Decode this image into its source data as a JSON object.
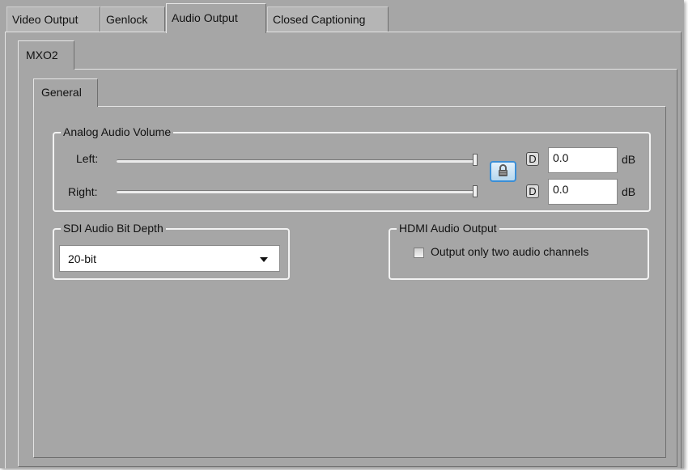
{
  "tabs": [
    "Video Output",
    "Genlock",
    "Audio Output",
    "Closed Captioning"
  ],
  "active_tab": "Audio Output",
  "device_tab": "MXO2",
  "section_tab": "General",
  "analog_volume": {
    "title": "Analog Audio Volume",
    "left_label": "Left:",
    "right_label": "Right:",
    "left_value": "0.0",
    "right_value": "0.0",
    "unit": "dB",
    "default_button": "D",
    "left_slider_level": 1.0,
    "right_slider_level": 1.0
  },
  "sdi_bit_depth": {
    "title": "SDI Audio Bit Depth",
    "selected": "20-bit"
  },
  "hdmi_output": {
    "title": "HDMI Audio Output",
    "checkbox_label": "Output only two audio channels",
    "checked": false
  },
  "colors": {
    "panel": "#a6a6a6",
    "lock_accent": "#3a8ed6"
  }
}
